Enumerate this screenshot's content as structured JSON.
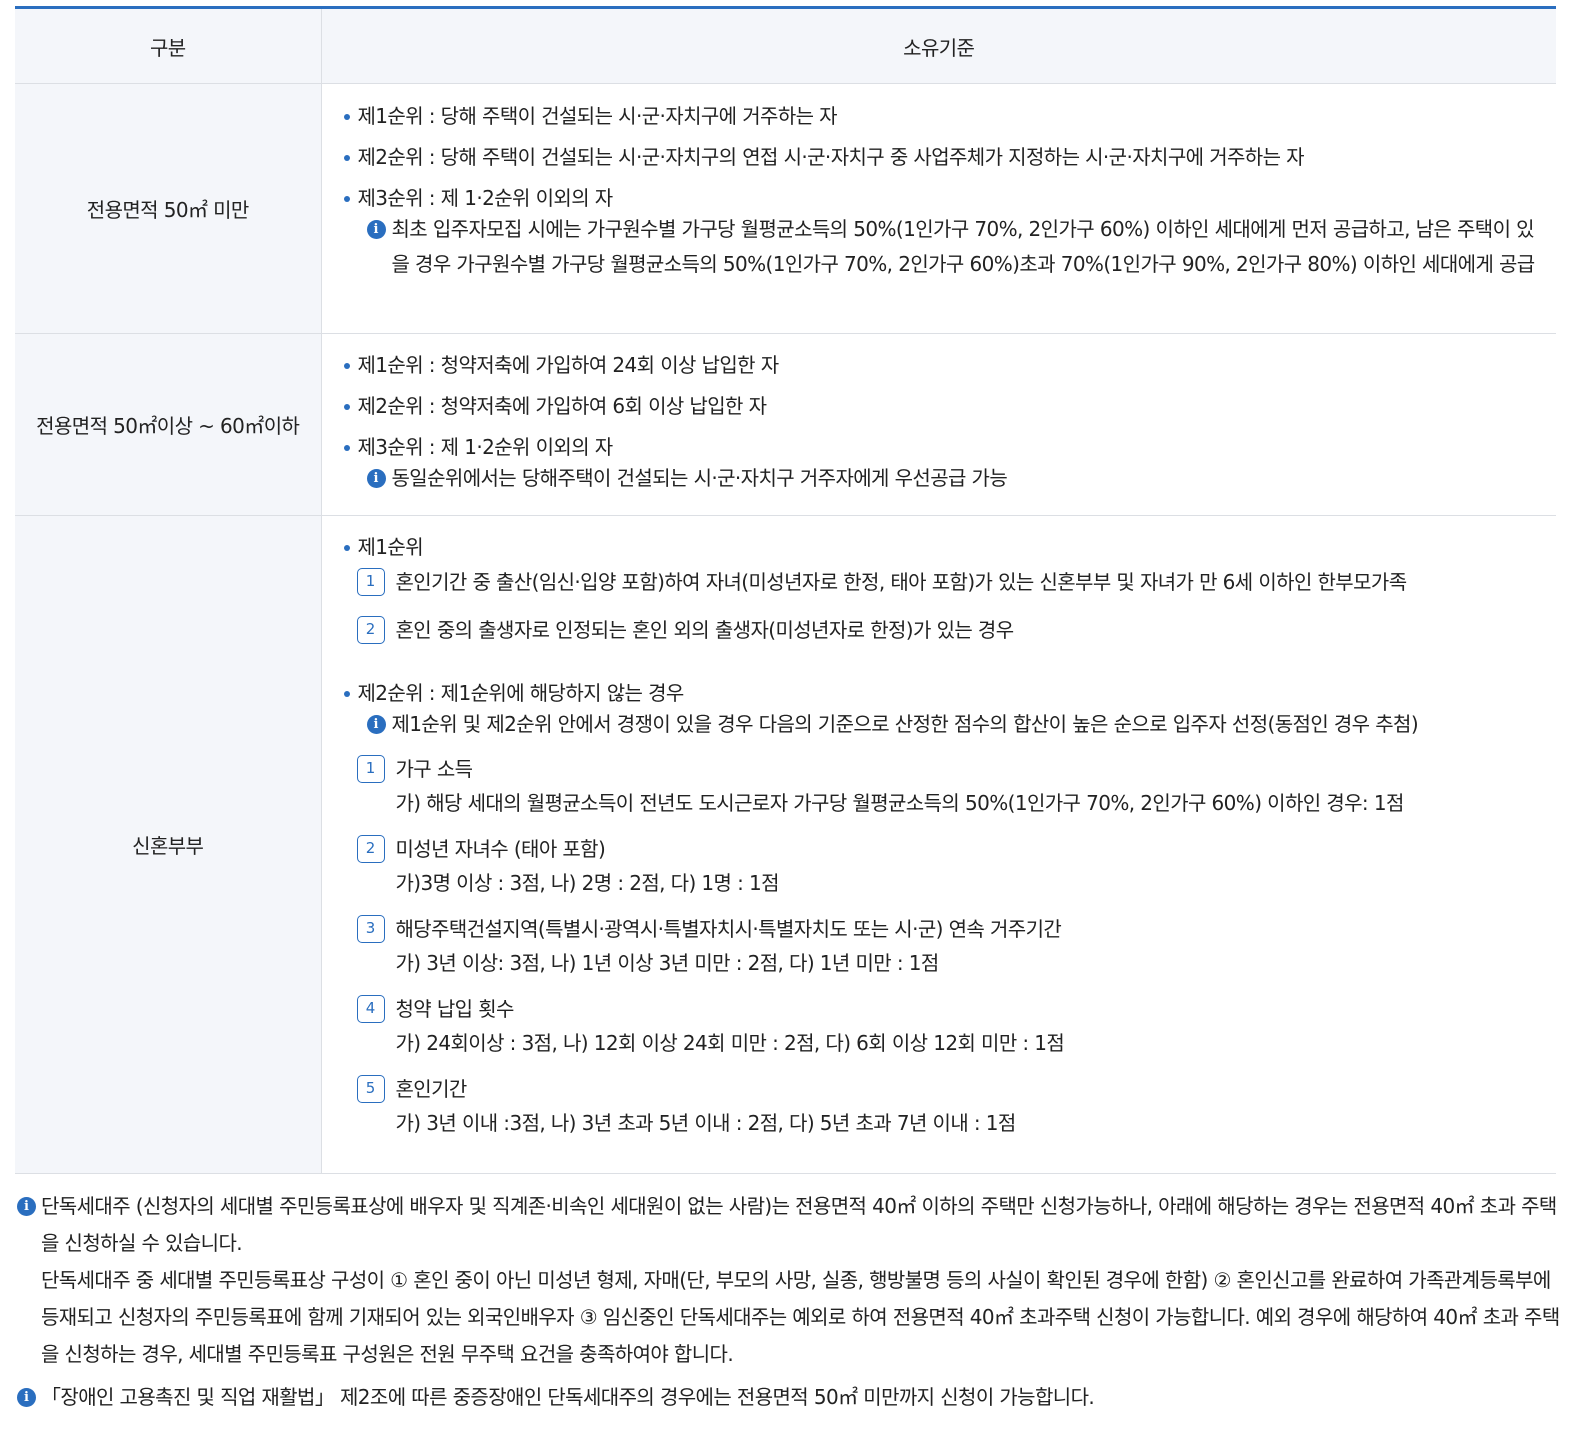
{
  "table": {
    "header": {
      "col1": "구분",
      "col2": "소유기준"
    },
    "row1": {
      "category": "전용면적 50㎡ 미만",
      "bullets": [
        "제1순위 : 당해 주택이 건설되는 시·군·자치구에 거주하는 자",
        "제2순위 : 당해 주택이 건설되는 시·군·자치구의 연접 시·군·자치구 중 사업주체가 지정하는 시·군·자치구에 거주하는 자",
        "제3순위 : 제 1·2순위 이외의 자"
      ],
      "info": "최초 입주자모집 시에는 가구원수별 가구당 월평균소득의 50%(1인가구 70%, 2인가구 60%) 이하인 세대에게 먼저 공급하고, 남은 주택이 있을 경우 가구원수별 가구당 월평균소득의 50%(1인가구 70%, 2인가구 60%)초과 70%(1인가구 90%, 2인가구 80%) 이하인 세대에게 공급"
    },
    "row2": {
      "category": "전용면적 50㎡이상 ~ 60㎡이하",
      "bullets": [
        "제1순위 : 청약저축에 가입하여 24회 이상 납입한 자",
        "제2순위 : 청약저축에 가입하여 6회 이상 납입한 자",
        "제3순위 : 제 1·2순위 이외의 자"
      ],
      "info": "동일순위에서는 당해주택이 건설되는 시·군·자치구 거주자에게 우선공급 가능"
    },
    "row3": {
      "category": "신혼부부",
      "first_rank": "제1순위",
      "first_items": [
        {
          "num": "1",
          "text": "혼인기간 중 출산(임신·입양 포함)하여 자녀(미성년자로 한정, 태아 포함)가 있는 신혼부부 및 자녀가 만 6세 이하인 한부모가족"
        },
        {
          "num": "2",
          "text": "혼인 중의 출생자로 인정되는 혼인 외의 출생자(미성년자로 한정)가 있는 경우"
        }
      ],
      "second_rank": "제2순위 : 제1순위에 해당하지 않는 경우",
      "info": "제1순위 및 제2순위 안에서 경쟁이 있을 경우 다음의 기준으로 산정한 점수의 합산이 높은 순으로 입주자 선정(동점인 경우 추첨)",
      "criteria": [
        {
          "num": "1",
          "title": "가구 소득",
          "detail": "가) 해당 세대의 월평균소득이 전년도 도시근로자 가구당 월평균소득의 50%(1인가구 70%, 2인가구 60%) 이하인 경우: 1점"
        },
        {
          "num": "2",
          "title": "미성년 자녀수 (태아 포함)",
          "detail": "가)3명 이상 : 3점, 나) 2명 : 2점, 다) 1명 : 1점"
        },
        {
          "num": "3",
          "title": "해당주택건설지역(특별시·광역시·특별자치시·특별자치도 또는 시·군) 연속 거주기간",
          "detail": "가) 3년 이상: 3점, 나) 1년 이상 3년 미만 : 2점, 다) 1년 미만 : 1점"
        },
        {
          "num": "4",
          "title": "청약 납입 횟수",
          "detail": "가) 24회이상 : 3점, 나) 12회 이상 24회 미만 : 2점, 다) 6회 이상 12회 미만 : 1점"
        },
        {
          "num": "5",
          "title": "혼인기간",
          "detail": "가) 3년 이내 :3점, 나) 3년 초과 5년 이내 : 2점, 다) 5년 초과 7년 이내 : 1점"
        }
      ]
    }
  },
  "notes": {
    "note1_a": "단독세대주 (신청자의 세대별 주민등록표상에 배우자 및 직계존·비속인 세대원이 없는 사람)는 전용면적 40㎡ 이하의 주택만 신청가능하나, 아래에 해당하는 경우는 전용면적 40㎡ 초과 주택을 신청하실 수 있습니다.",
    "note1_b": "단독세대주 중 세대별 주민등록표상 구성이 ① 혼인 중이 아닌 미성년 형제, 자매(단, 부모의 사망, 실종, 행방불명 등의 사실이 확인된 경우에 한함) ② 혼인신고를 완료하여 가족관계등록부에 등재되고 신청자의 주민등록표에 함께 기재되어 있는 외국인배우자 ③ 임신중인 단독세대주는 예외로 하여 전용면적 40㎡ 초과주택 신청이 가능합니다. 예외 경우에 해당하여 40㎡ 초과 주택을 신청하는 경우, 세대별 주민등록표 구성원은 전원 무주택 요건을 충족하여야 합니다.",
    "note2": "「장애인 고용촉진 및 직업 재활법」 제2조에 따른 중증장애인 단독세대주의 경우에는 전용면적 50㎡ 미만까지 신청이 가능합니다."
  }
}
